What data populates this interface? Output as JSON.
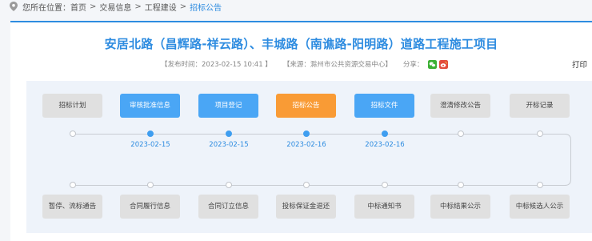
{
  "breadcrumb": {
    "prefix": "您所在位置：",
    "items": [
      "首页",
      "交易信息",
      "工程建设",
      "招标公告"
    ],
    "separator": ">"
  },
  "title": "安居北路（昌辉路-祥云路）、丰城路（南谯路-阳明路）道路工程施工项目",
  "meta": {
    "publish": "【发布时间：2023-02-15 10:41 】",
    "source": "【来源：滁州市公共资源交易中心】",
    "share_label": "分享：",
    "print": "打印"
  },
  "colors": {
    "accent": "#2e8ce0",
    "active_step": "#4aa6f5",
    "current_step": "#f99b35",
    "inactive_step": "#e0e0e0"
  },
  "flow": {
    "top_steps": [
      {
        "label": "招标计划",
        "state": "inactive"
      },
      {
        "label": "审核批准信息",
        "state": "active"
      },
      {
        "label": "项目登记",
        "state": "active"
      },
      {
        "label": "招标公告",
        "state": "current"
      },
      {
        "label": "招标文件",
        "state": "active"
      },
      {
        "label": "澄清修改公告",
        "state": "inactive"
      },
      {
        "label": "开标记录",
        "state": "inactive"
      }
    ],
    "top_dates": [
      "",
      "2023-02-15",
      "2023-02-15",
      "2023-02-16",
      "2023-02-16",
      "",
      ""
    ],
    "bottom_steps": [
      {
        "label": "暂停、流标通告",
        "state": "inactive"
      },
      {
        "label": "合同履行信息",
        "state": "inactive"
      },
      {
        "label": "合同订立信息",
        "state": "inactive"
      },
      {
        "label": "投标保证金退还",
        "state": "inactive"
      },
      {
        "label": "中标通知书",
        "state": "inactive"
      },
      {
        "label": "中标结果公示",
        "state": "inactive"
      },
      {
        "label": "中标候选人公示",
        "state": "inactive"
      }
    ]
  }
}
